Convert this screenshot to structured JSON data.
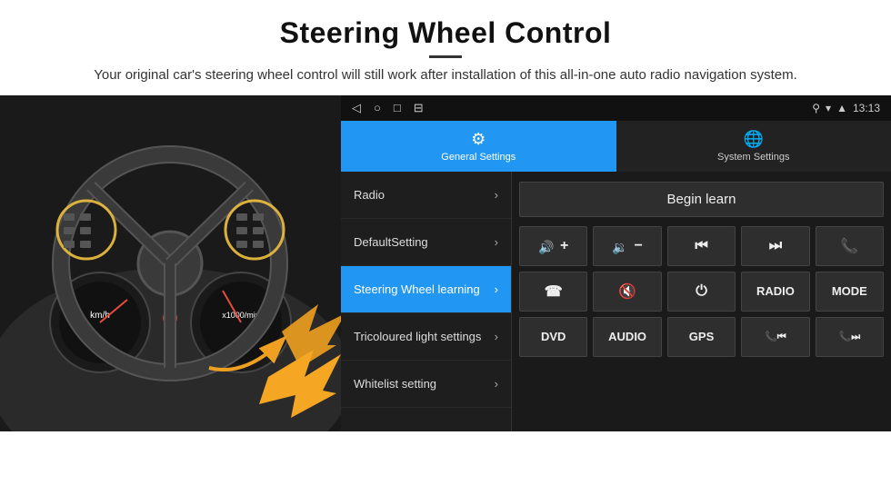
{
  "header": {
    "title": "Steering Wheel Control",
    "subtitle": "Your original car's steering wheel control will still work after installation of this all-in-one auto radio navigation system."
  },
  "statusBar": {
    "time": "13:13",
    "icons": [
      "◁",
      "○",
      "□",
      "⊟"
    ]
  },
  "tabs": [
    {
      "id": "general",
      "label": "General Settings",
      "active": true
    },
    {
      "id": "system",
      "label": "System Settings",
      "active": false
    }
  ],
  "menuItems": [
    {
      "id": "radio",
      "label": "Radio",
      "active": false
    },
    {
      "id": "default-setting",
      "label": "DefaultSetting",
      "active": false
    },
    {
      "id": "steering-wheel",
      "label": "Steering Wheel learning",
      "active": true
    },
    {
      "id": "tricoloured-light",
      "label": "Tricoloured light settings",
      "active": false
    },
    {
      "id": "whitelist",
      "label": "Whitelist setting",
      "active": false
    }
  ],
  "controls": {
    "beginLearnLabel": "Begin learn",
    "row1": [
      {
        "id": "vol-up",
        "icon": "🔊+",
        "label": "volume up"
      },
      {
        "id": "vol-down",
        "icon": "🔉−",
        "label": "volume down"
      },
      {
        "id": "prev",
        "icon": "⏮",
        "label": "previous"
      },
      {
        "id": "next",
        "icon": "⏭",
        "label": "next"
      },
      {
        "id": "phone",
        "icon": "📞",
        "label": "phone"
      }
    ],
    "row2": [
      {
        "id": "call",
        "icon": "📞",
        "label": "call answer"
      },
      {
        "id": "mute",
        "icon": "🔇",
        "label": "mute"
      },
      {
        "id": "power",
        "icon": "⏻",
        "label": "power"
      },
      {
        "id": "radio-btn",
        "text": "RADIO",
        "label": "radio"
      },
      {
        "id": "mode-btn",
        "text": "MODE",
        "label": "mode"
      }
    ],
    "row3": [
      {
        "id": "dvd-btn",
        "text": "DVD",
        "label": "dvd"
      },
      {
        "id": "audio-btn",
        "text": "AUDIO",
        "label": "audio"
      },
      {
        "id": "gps-btn",
        "text": "GPS",
        "label": "gps"
      },
      {
        "id": "phone-prev",
        "icon": "📞⏮",
        "label": "phone prev"
      },
      {
        "id": "phone-next",
        "icon": "📞⏭",
        "label": "phone next"
      }
    ]
  }
}
